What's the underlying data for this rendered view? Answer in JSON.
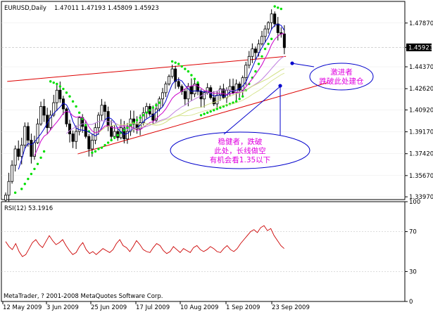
{
  "header": {
    "symbol": "EURUSD,Daily",
    "ohlc": "1.47011 1.47193 1.45809 1.45923"
  },
  "rsi_header": "RSI(12) 53.1916",
  "copyright": "MetaTrader, ? 2001-2008 MetaQuotes Software Corp.",
  "annotations": {
    "aggressive": [
      "激进者",
      "跌破此处建仓"
    ],
    "conservative": [
      "稳健者，跌破",
      "此处，长线做空",
      "有机会看1.35以下"
    ]
  },
  "colors": {
    "background": "#ffffff",
    "candle": "#000000",
    "sar": "#00e000",
    "trendline": "#dd0000",
    "ma_fast": "#0000cc",
    "ma_mid": "#cc00cc",
    "ma_slow": "#c080e0",
    "ma_slowest": "#d0e080",
    "rsi_line": "#cc0000",
    "callout": "#0000cc",
    "note_text": "#e000e0"
  },
  "chart_data": [
    {
      "type": "candlestick",
      "title": "EURUSD,Daily",
      "price_ticks": [
        "1.47870",
        "1.44370",
        "1.42620",
        "1.40920",
        "1.39170",
        "1.37420",
        "1.35670",
        "1.33970"
      ],
      "current_price": "1.45923",
      "date_ticks": [
        "12 May 2009",
        "3 Jun 2009",
        "25 Jun 2009",
        "17 Jul 2009",
        "10 Aug 2009",
        "1 Sep 2009",
        "23 Sep 2009"
      ],
      "ylim": [
        1.3375,
        1.496
      ],
      "close": [
        1.341,
        1.352,
        1.365,
        1.378,
        1.372,
        1.381,
        1.396,
        1.385,
        1.372,
        1.383,
        1.398,
        1.412,
        1.405,
        1.395,
        1.405,
        1.415,
        1.425,
        1.418,
        1.41,
        1.398,
        1.39,
        1.384,
        1.392,
        1.403,
        1.396,
        1.388,
        1.378,
        1.385,
        1.395,
        1.405,
        1.413,
        1.408,
        1.396,
        1.388,
        1.392,
        1.387,
        1.395,
        1.386,
        1.392,
        1.402,
        1.398,
        1.394,
        1.399,
        1.407,
        1.412,
        1.406,
        1.401,
        1.41,
        1.418,
        1.423,
        1.43,
        1.436,
        1.442,
        1.432,
        1.428,
        1.424,
        1.418,
        1.428,
        1.422,
        1.43,
        1.424,
        1.418,
        1.423,
        1.427,
        1.419,
        1.414,
        1.421,
        1.426,
        1.419,
        1.425,
        1.428,
        1.423,
        1.43,
        1.425,
        1.435,
        1.445,
        1.452,
        1.458,
        1.455,
        1.462,
        1.468,
        1.474,
        1.479,
        1.486,
        1.478,
        1.471,
        1.47,
        1.459
      ],
      "sar_dots": [
        {
          "i": 3,
          "v": 1.343
        },
        {
          "i": 5,
          "v": 1.346
        },
        {
          "i": 6,
          "v": 1.35
        },
        {
          "i": 7,
          "v": 1.354
        },
        {
          "i": 8,
          "v": 1.358
        },
        {
          "i": 9,
          "v": 1.362
        },
        {
          "i": 10,
          "v": 1.366
        },
        {
          "i": 11,
          "v": 1.371
        },
        {
          "i": 12,
          "v": 1.376
        },
        {
          "i": 14,
          "v": 1.432
        },
        {
          "i": 15,
          "v": 1.431
        },
        {
          "i": 16,
          "v": 1.43
        },
        {
          "i": 17,
          "v": 1.428
        },
        {
          "i": 18,
          "v": 1.426
        },
        {
          "i": 19,
          "v": 1.423
        },
        {
          "i": 20,
          "v": 1.42
        },
        {
          "i": 21,
          "v": 1.416
        },
        {
          "i": 22,
          "v": 1.412
        },
        {
          "i": 23,
          "v": 1.407
        },
        {
          "i": 24,
          "v": 1.402
        },
        {
          "i": 25,
          "v": 1.397
        },
        {
          "i": 26,
          "v": 1.392
        },
        {
          "i": 27,
          "v": 1.375
        },
        {
          "i": 28,
          "v": 1.376
        },
        {
          "i": 29,
          "v": 1.378
        },
        {
          "i": 30,
          "v": 1.379
        },
        {
          "i": 31,
          "v": 1.381
        },
        {
          "i": 32,
          "v": 1.383
        },
        {
          "i": 33,
          "v": 1.385
        },
        {
          "i": 34,
          "v": 1.387
        },
        {
          "i": 35,
          "v": 1.389
        },
        {
          "i": 36,
          "v": 1.391
        },
        {
          "i": 37,
          "v": 1.393
        },
        {
          "i": 38,
          "v": 1.395
        },
        {
          "i": 39,
          "v": 1.397
        },
        {
          "i": 40,
          "v": 1.399
        },
        {
          "i": 41,
          "v": 1.401
        },
        {
          "i": 42,
          "v": 1.403
        },
        {
          "i": 43,
          "v": 1.405
        },
        {
          "i": 44,
          "v": 1.407
        },
        {
          "i": 45,
          "v": 1.409
        },
        {
          "i": 46,
          "v": 1.411
        },
        {
          "i": 47,
          "v": 1.413
        },
        {
          "i": 48,
          "v": 1.415
        },
        {
          "i": 52,
          "v": 1.448
        },
        {
          "i": 53,
          "v": 1.447
        },
        {
          "i": 54,
          "v": 1.446
        },
        {
          "i": 55,
          "v": 1.444
        },
        {
          "i": 56,
          "v": 1.442
        },
        {
          "i": 57,
          "v": 1.44
        },
        {
          "i": 58,
          "v": 1.437
        },
        {
          "i": 59,
          "v": 1.434
        },
        {
          "i": 60,
          "v": 1.431
        },
        {
          "i": 61,
          "v": 1.405
        },
        {
          "i": 62,
          "v": 1.406
        },
        {
          "i": 63,
          "v": 1.407
        },
        {
          "i": 64,
          "v": 1.408
        },
        {
          "i": 65,
          "v": 1.409
        },
        {
          "i": 66,
          "v": 1.41
        },
        {
          "i": 67,
          "v": 1.411
        },
        {
          "i": 68,
          "v": 1.412
        },
        {
          "i": 69,
          "v": 1.413
        },
        {
          "i": 70,
          "v": 1.414
        },
        {
          "i": 71,
          "v": 1.415
        },
        {
          "i": 72,
          "v": 1.416
        },
        {
          "i": 73,
          "v": 1.418
        },
        {
          "i": 74,
          "v": 1.42
        },
        {
          "i": 75,
          "v": 1.425
        },
        {
          "i": 76,
          "v": 1.43
        },
        {
          "i": 77,
          "v": 1.435
        },
        {
          "i": 78,
          "v": 1.44
        },
        {
          "i": 79,
          "v": 1.446
        },
        {
          "i": 80,
          "v": 1.452
        },
        {
          "i": 81,
          "v": 1.458
        },
        {
          "i": 82,
          "v": 1.462
        },
        {
          "i": 83,
          "v": 1.466
        },
        {
          "i": 84,
          "v": 1.492
        },
        {
          "i": 85,
          "v": 1.491
        },
        {
          "i": 86,
          "v": 1.49
        }
      ],
      "upper_trendline": [
        [
          0.5,
          1.432
        ],
        [
          87.5,
          1.452
        ]
      ],
      "lower_trendline": [
        [
          22.5,
          1.374
        ],
        [
          100.5,
          1.431
        ]
      ],
      "aggressive_marker_price": 1.4465,
      "conservative_marker_price": 1.4285
    },
    {
      "type": "line",
      "title": "RSI(12) 53.1916",
      "y_ticks": [
        "100",
        "70",
        "30",
        "0"
      ],
      "ylim": [
        0,
        100
      ],
      "values": [
        60,
        55,
        52,
        58,
        50,
        45,
        47,
        53,
        59,
        62,
        57,
        54,
        60,
        66,
        61,
        57,
        59,
        62,
        56,
        51,
        47,
        49,
        55,
        59,
        52,
        48,
        50,
        47,
        50,
        53,
        51,
        49,
        52,
        58,
        62,
        56,
        54,
        50,
        55,
        61,
        57,
        52,
        50,
        49,
        54,
        58,
        56,
        51,
        48,
        50,
        55,
        52,
        49,
        53,
        51,
        49,
        54,
        56,
        52,
        50,
        52,
        55,
        53,
        50,
        49,
        53,
        56,
        52,
        50,
        53,
        58,
        62,
        66,
        70,
        72,
        69,
        74,
        76,
        71,
        73,
        66,
        61,
        56,
        53
      ]
    }
  ]
}
